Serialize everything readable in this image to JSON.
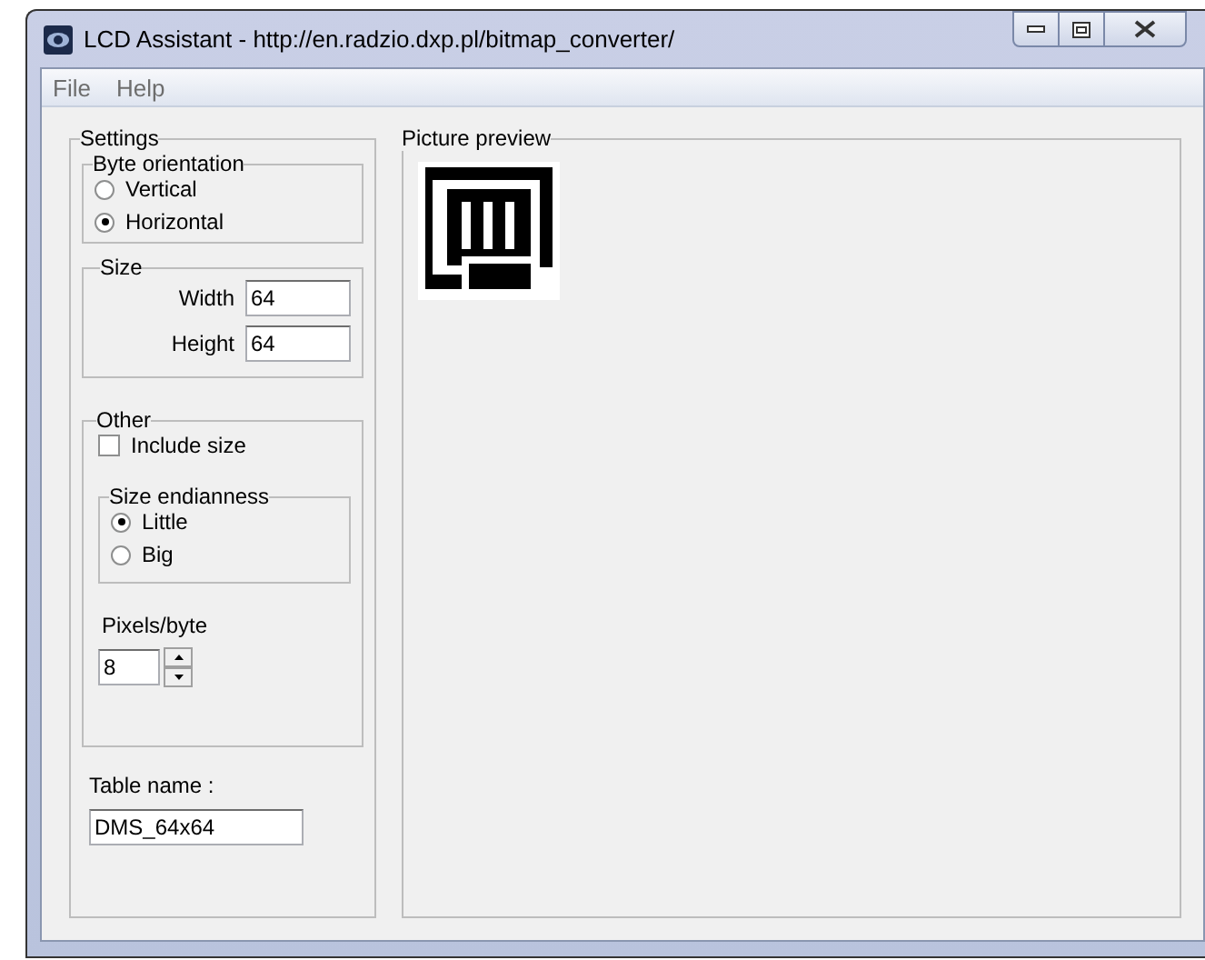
{
  "window": {
    "title": "LCD Assistant - http://en.radzio.dxp.pl/bitmap_converter/"
  },
  "menu": [
    "File",
    "Help"
  ],
  "settings": {
    "title": "Settings",
    "byte_orientation": {
      "title": "Byte orientation",
      "options": [
        {
          "label": "Vertical",
          "selected": false
        },
        {
          "label": "Horizontal",
          "selected": true
        }
      ]
    },
    "size": {
      "title": "Size",
      "fields": [
        {
          "label": "Width",
          "value": "64"
        },
        {
          "label": "Height",
          "value": "64"
        }
      ]
    },
    "other": {
      "title": "Other",
      "include_size": {
        "label": "Include size",
        "checked": false
      },
      "size_endianness": {
        "title": "Size endianness",
        "options": [
          {
            "label": "Little",
            "selected": true
          },
          {
            "label": "Big",
            "selected": false
          }
        ]
      },
      "pixels_per_byte": {
        "label": "Pixels/byte",
        "value": "8"
      }
    },
    "table_name": {
      "label": "Table name :",
      "value": "DMS_64x64"
    }
  },
  "preview": {
    "title": "Picture preview"
  }
}
